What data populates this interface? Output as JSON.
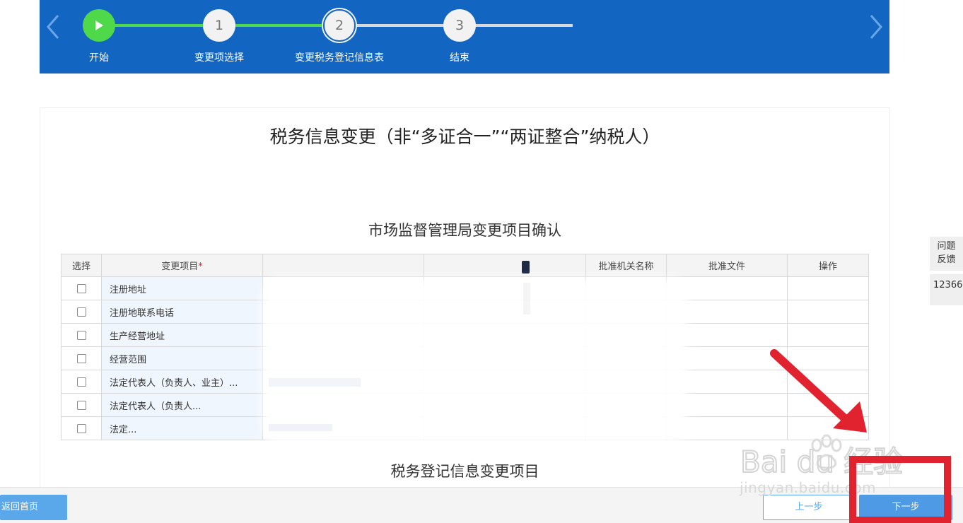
{
  "steps": [
    {
      "marker": "",
      "label": "开始",
      "state": "done"
    },
    {
      "marker": "1",
      "label": "变更项选择",
      "state": "done"
    },
    {
      "marker": "2",
      "label": "变更税务登记信息表",
      "state": "current"
    },
    {
      "marker": "3",
      "label": "结束",
      "state": "pending"
    }
  ],
  "colors": {
    "banner": "#1266c2",
    "done_green": "#4fd84a",
    "track_pending": "#d8d8d8",
    "primary_button": "#4f9ae4",
    "annotation_red": "#e0232f"
  },
  "icons": {
    "prev": "chevron-left-icon",
    "next": "chevron-right-icon",
    "start": "play-icon"
  },
  "page_title": "税务信息变更（非“多证合一”“两证整合”纳税人）",
  "section1_title": "市场监督管理局变更项目确认",
  "section2_title": "税务登记信息变更项目",
  "table": {
    "headers": [
      "选择",
      "变更项目",
      "",
      "",
      "批准机关名称",
      "批准文件",
      "操作"
    ],
    "required_mark": "*",
    "rows": [
      {
        "name": "注册地址"
      },
      {
        "name": "注册地联系电话"
      },
      {
        "name": "生产经营地址"
      },
      {
        "name": "经营范围"
      },
      {
        "name": "法定代表人（负责人、业主）..."
      },
      {
        "name": "法定代表人（负责人..."
      },
      {
        "name": "法定..."
      }
    ]
  },
  "side": {
    "feedback": "问题反馈",
    "hotline": "12366"
  },
  "footer": {
    "home": "返回首页",
    "prev": "上一步",
    "next": "下一步"
  },
  "watermark": {
    "logo": "Baidu经验",
    "url": "jingyan.baidu.com"
  }
}
